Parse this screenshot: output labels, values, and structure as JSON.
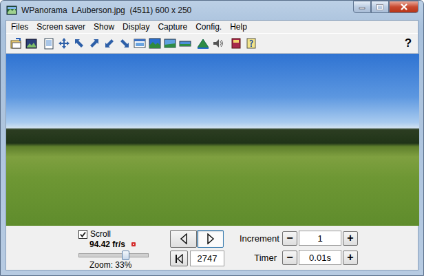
{
  "window": {
    "title": "WPanorama  LAuberson.jpg  (4511) 600 x 250"
  },
  "menu": [
    {
      "label": "Files"
    },
    {
      "label": "Screen saver"
    },
    {
      "label": "Show"
    },
    {
      "label": "Display"
    },
    {
      "label": "Capture"
    },
    {
      "label": "Config."
    },
    {
      "label": "Help"
    }
  ],
  "toolbar": {
    "help_label": "?"
  },
  "controls": {
    "scroll": {
      "label": "Scroll",
      "checked": true
    },
    "rate": "94.42 fr/s",
    "zoom": {
      "label": "Zoom: 33%",
      "level": 0.67
    },
    "nav": {
      "back_selected": false,
      "forward_selected": true
    },
    "frame": "2747",
    "steppers": [
      {
        "label": "Increment",
        "value": "1",
        "minus": "−",
        "plus": "+"
      },
      {
        "label": "Timer",
        "value": "0.01s",
        "minus": "−",
        "plus": "+"
      }
    ]
  }
}
